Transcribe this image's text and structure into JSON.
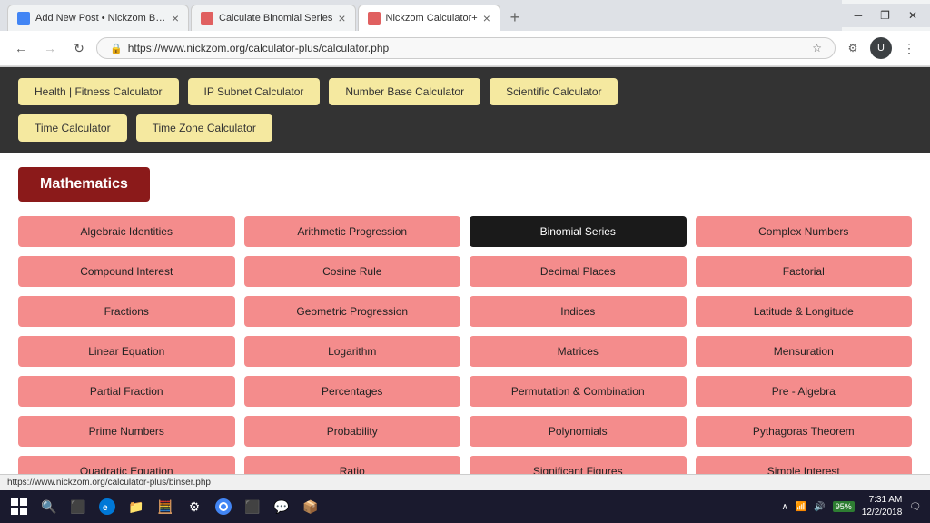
{
  "browser": {
    "tabs": [
      {
        "id": "tab1",
        "favicon_color": "#4285f4",
        "title": "Add New Post • Nickzom Blog –",
        "active": false
      },
      {
        "id": "tab2",
        "favicon_color": "#e06060",
        "title": "Calculate Binomial Series",
        "active": false
      },
      {
        "id": "tab3",
        "favicon_color": "#e06060",
        "title": "Nickzom Calculator+",
        "active": true
      }
    ],
    "url": "https://www.nickzom.org/calculator-plus/calculator.php",
    "new_tab_label": "+",
    "back_disabled": false,
    "forward_disabled": true
  },
  "calc_bar": {
    "row1": [
      "Health | Fitness Calculator",
      "IP Subnet Calculator",
      "Number Base Calculator",
      "Scientific Calculator"
    ],
    "row2": [
      "Time Calculator",
      "Time Zone Calculator"
    ]
  },
  "math_section": {
    "title": "Mathematics",
    "items": [
      {
        "label": "Algebraic Identities",
        "active": false
      },
      {
        "label": "Arithmetic Progression",
        "active": false
      },
      {
        "label": "Binomial Series",
        "active": true
      },
      {
        "label": "Complex Numbers",
        "active": false
      },
      {
        "label": "Compound Interest",
        "active": false
      },
      {
        "label": "Cosine Rule",
        "active": false
      },
      {
        "label": "Decimal Places",
        "active": false
      },
      {
        "label": "Factorial",
        "active": false
      },
      {
        "label": "Fractions",
        "active": false
      },
      {
        "label": "Geometric Progression",
        "active": false
      },
      {
        "label": "Indices",
        "active": false
      },
      {
        "label": "Latitude & Longitude",
        "active": false
      },
      {
        "label": "Linear Equation",
        "active": false
      },
      {
        "label": "Logarithm",
        "active": false
      },
      {
        "label": "Matrices",
        "active": false
      },
      {
        "label": "Mensuration",
        "active": false
      },
      {
        "label": "Partial Fraction",
        "active": false
      },
      {
        "label": "Percentages",
        "active": false
      },
      {
        "label": "Permutation & Combination",
        "active": false
      },
      {
        "label": "Pre - Algebra",
        "active": false
      },
      {
        "label": "Prime Numbers",
        "active": false
      },
      {
        "label": "Probability",
        "active": false
      },
      {
        "label": "Polynomials",
        "active": false
      },
      {
        "label": "Pythagoras Theorem",
        "active": false
      },
      {
        "label": "Quadratic Equation",
        "active": false
      },
      {
        "label": "Ratio",
        "active": false
      },
      {
        "label": "Significant Figures",
        "active": false
      },
      {
        "label": "Simple Interest",
        "active": false
      }
    ]
  },
  "taskbar": {
    "status_url": "https://www.nickzom.org/calculator-plus/binser.php",
    "battery": "95%",
    "time": "7:31 AM",
    "date": "12/2/2018"
  }
}
